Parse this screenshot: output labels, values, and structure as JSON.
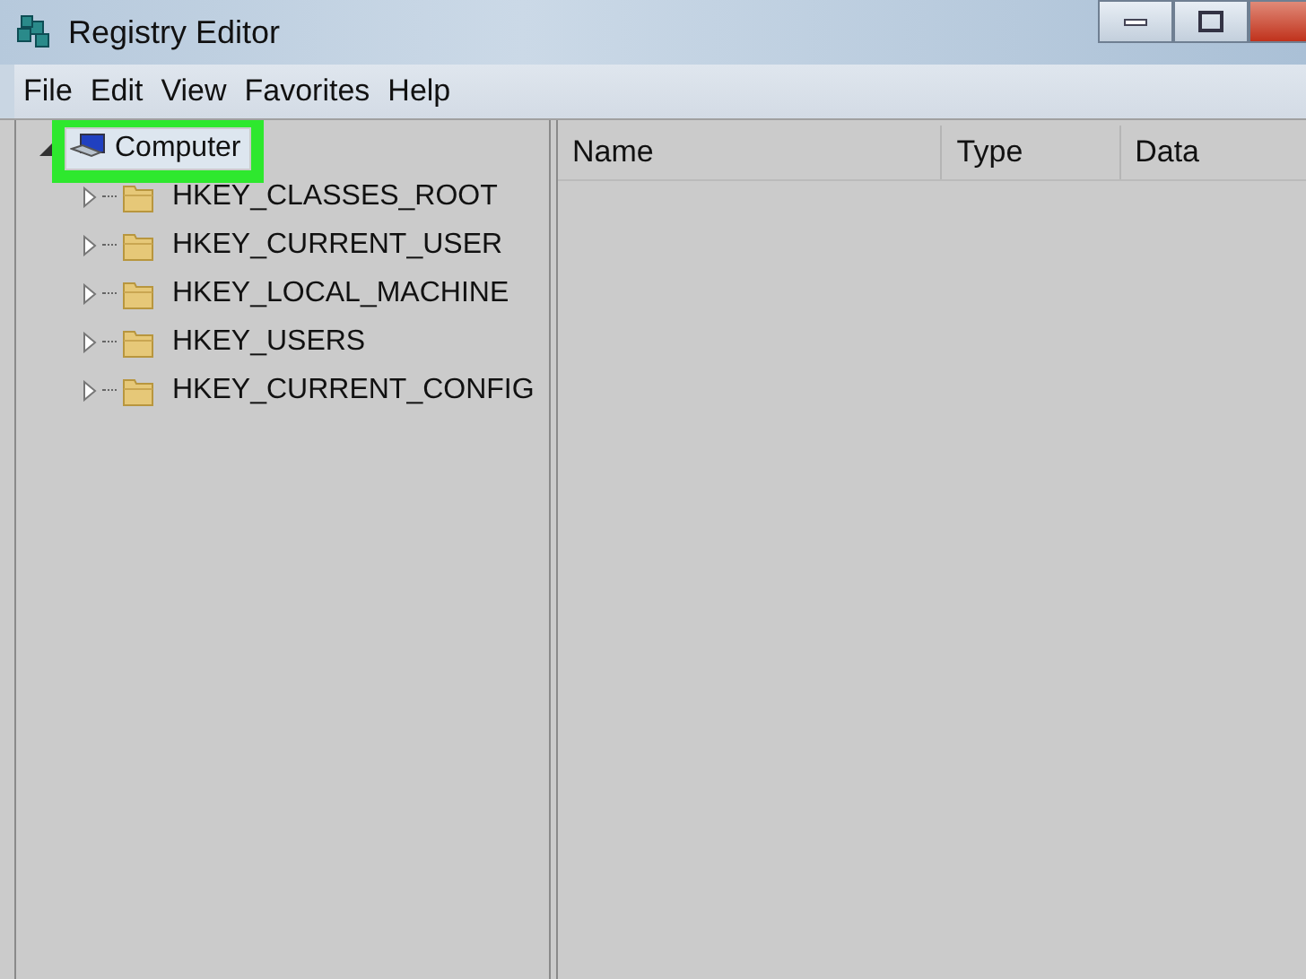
{
  "window": {
    "title": "Registry Editor"
  },
  "menu": [
    "File",
    "Edit",
    "View",
    "Favorites",
    "Help"
  ],
  "tree": {
    "label": "Computer",
    "expanded": true,
    "highlighted": true,
    "children": [
      {
        "label": "HKEY_CLASSES_ROOT",
        "expanded": false
      },
      {
        "label": "HKEY_CURRENT_USER",
        "expanded": false
      },
      {
        "label": "HKEY_LOCAL_MACHINE",
        "expanded": false
      },
      {
        "label": "HKEY_USERS",
        "expanded": false
      },
      {
        "label": "HKEY_CURRENT_CONFIG",
        "expanded": false
      }
    ]
  },
  "list": {
    "columns": [
      "Name",
      "Type",
      "Data"
    ]
  }
}
